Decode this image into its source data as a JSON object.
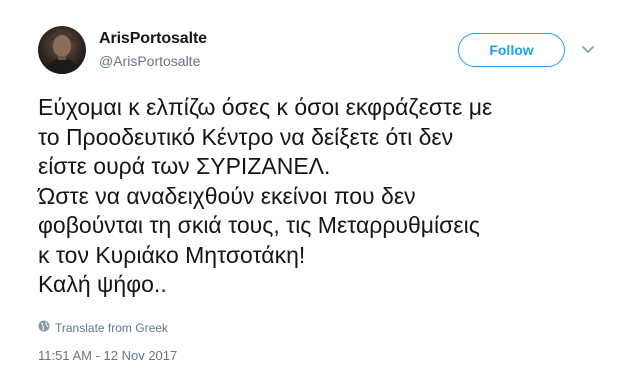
{
  "tweet": {
    "display_name": "ArisPortosalte",
    "handle": "@ArisPortosalte",
    "follow_label": "Follow",
    "text": "Εύχομαι κ ελπίζω όσες κ όσοι εκφράζεστε με\nτο Προοδευτικό Κέντρο να δείξετε ότι δεν\nείστε ουρά των ΣΥΡΙΖΑΝΕΛ.\nΏστε να αναδειχθούν εκείνοι που δεν\nφοβούνται τη σκιά τους, τις Μεταρρυθμίσεις\nκ τον Κυριάκο Μητσοτάκη!\nΚαλή ψήφο..",
    "translate_label": "Translate from Greek",
    "timestamp": "11:51 AM - 12 Nov 2017"
  },
  "icons": {
    "more": "chevron-down-icon",
    "translate": "globe-icon"
  },
  "colors": {
    "accent": "#1da1f2",
    "text": "#14171a",
    "secondary": "#657786"
  }
}
